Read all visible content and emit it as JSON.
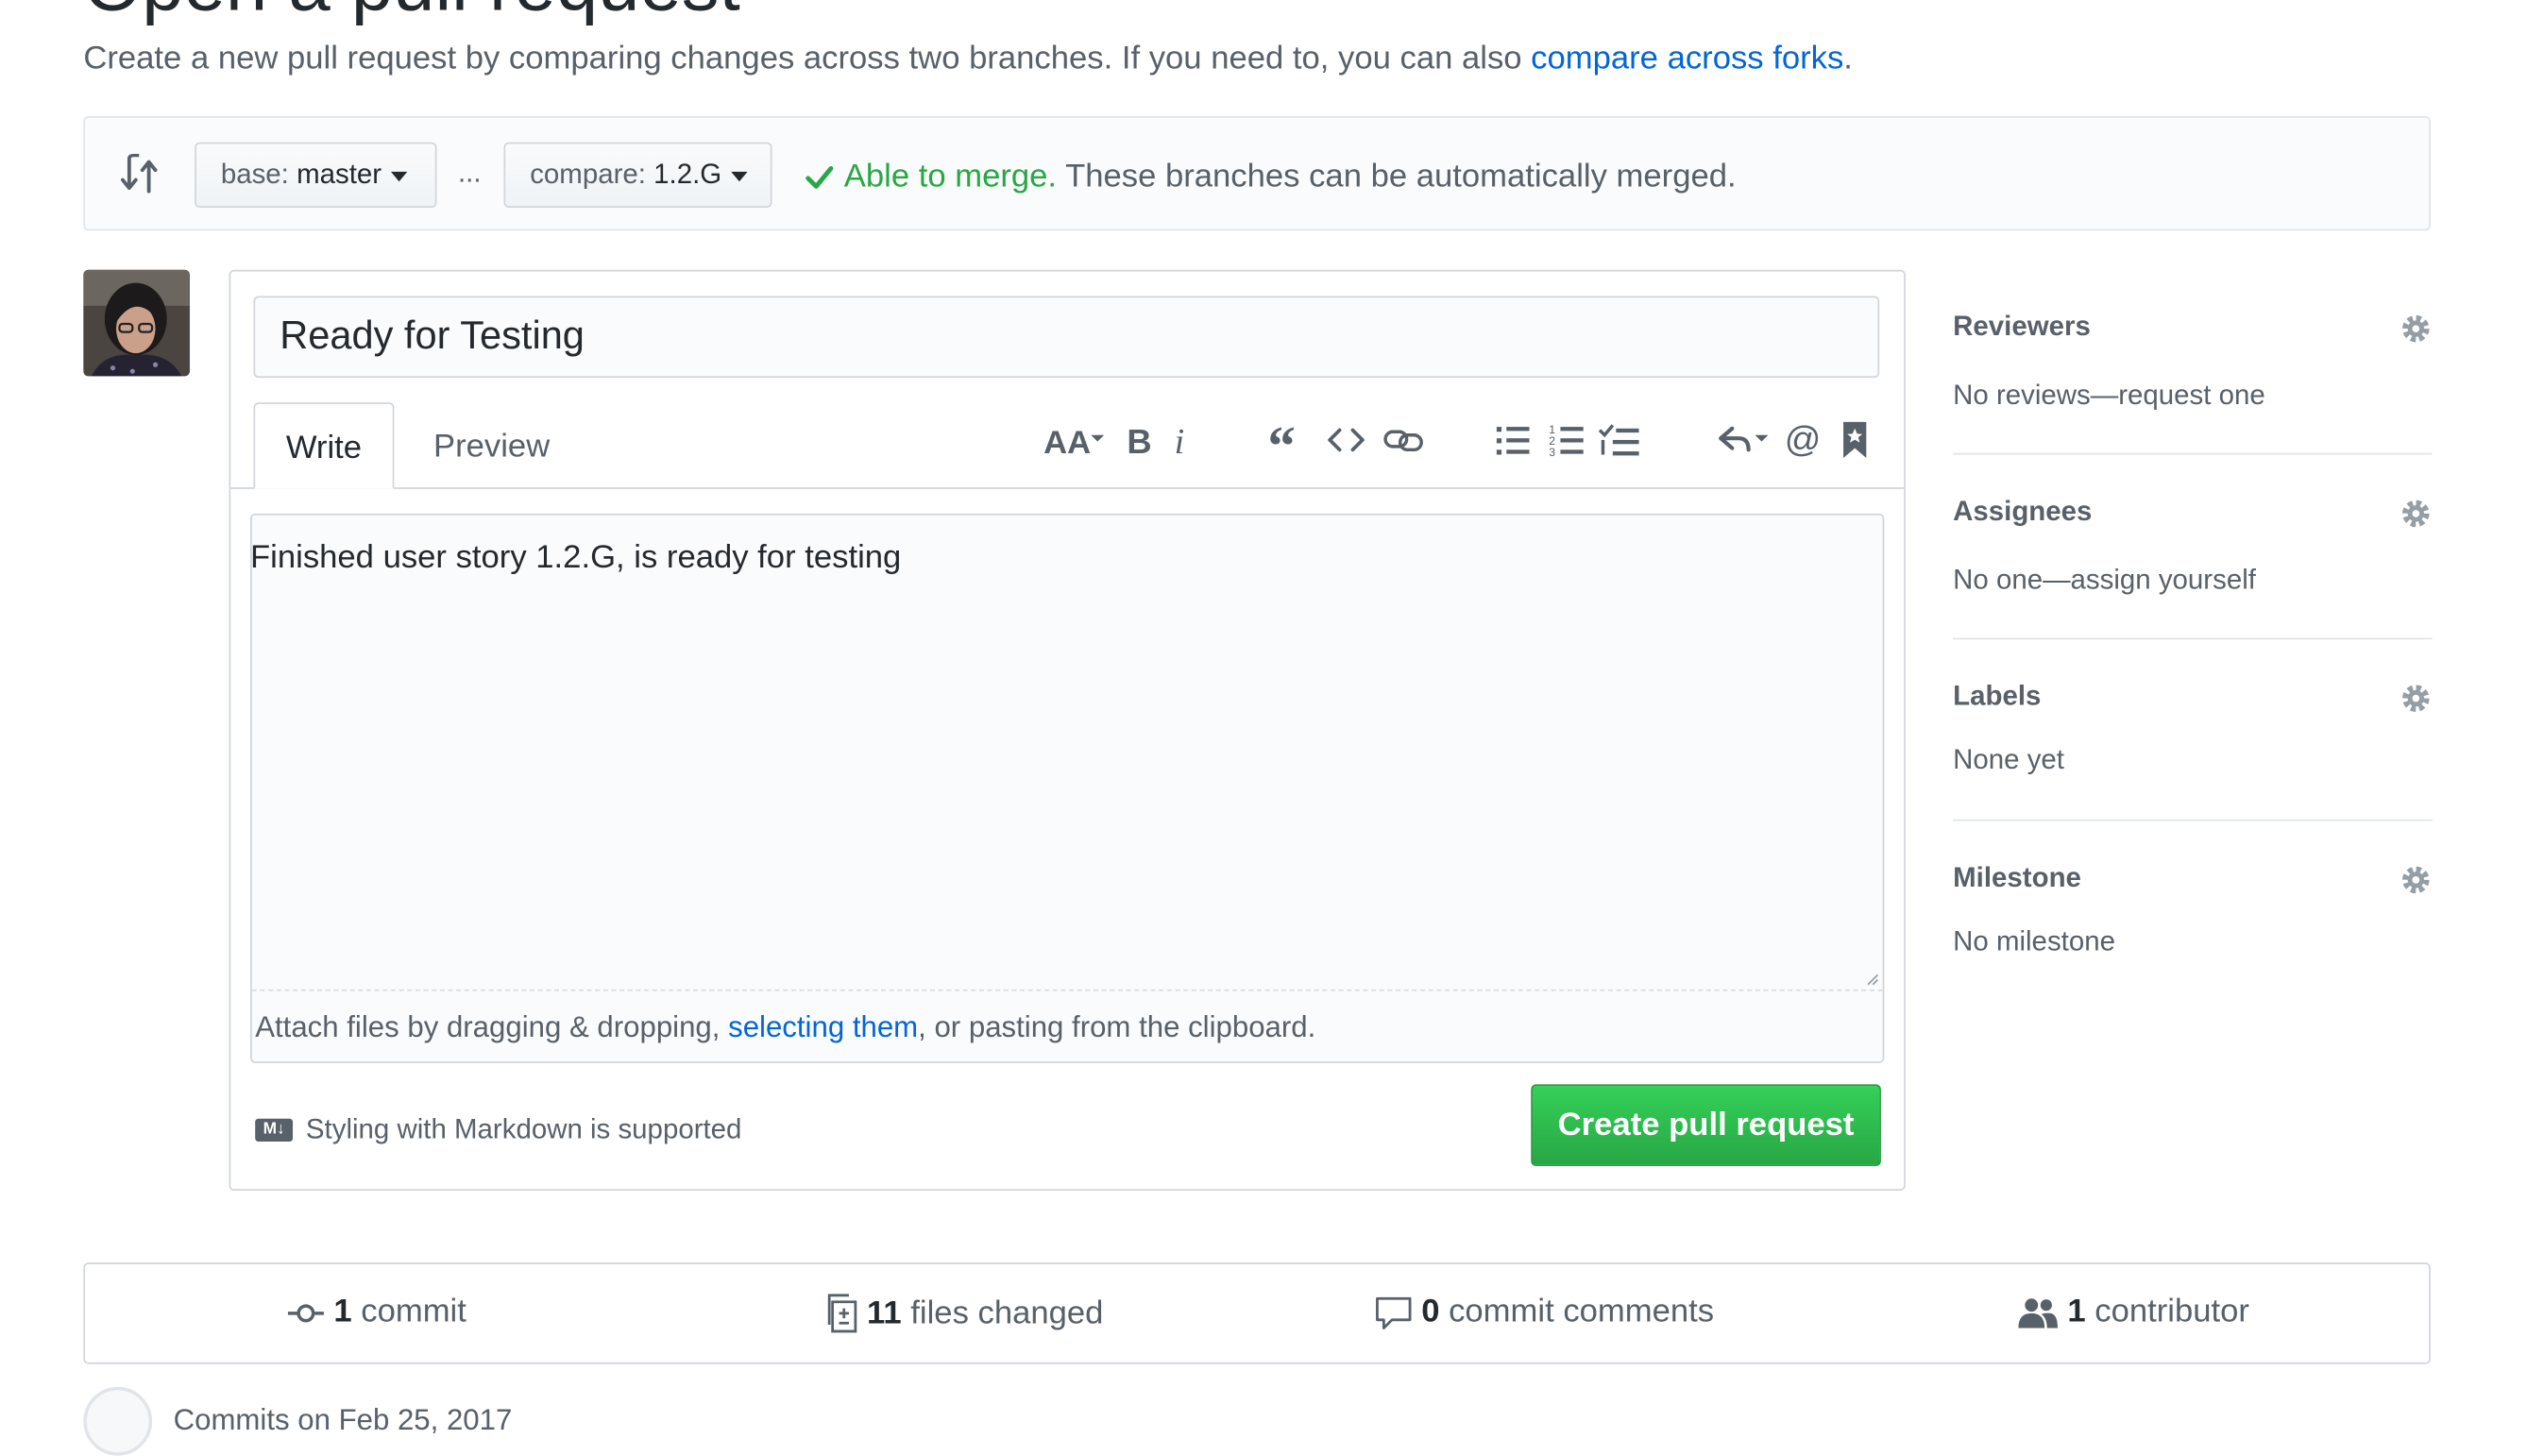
{
  "page": {
    "title": "Open a pull request",
    "subtitle_prefix": "Create a new pull request by comparing changes across two branches. If you need to, you can also ",
    "subtitle_link": "compare across forks",
    "subtitle_suffix": "."
  },
  "range": {
    "base_label": "base:",
    "base_branch": "master",
    "separator": "...",
    "compare_label": "compare:",
    "compare_branch": "1.2.G",
    "merge_status": "Able to merge.",
    "merge_message": " These branches can be automatically merged."
  },
  "composer": {
    "title_value": "Ready for Testing",
    "tab_write": "Write",
    "tab_preview": "Preview",
    "toolbar": [
      "header-text",
      "bold",
      "italic",
      "quote",
      "code",
      "link",
      "unordered-list",
      "ordered-list",
      "task-list",
      "reply",
      "mention",
      "saved-reply"
    ],
    "body_value": "Finished user story 1.2.G, is ready for testing",
    "attach_prefix": "Attach files by dragging & dropping, ",
    "attach_link": "selecting them",
    "attach_suffix": ", or pasting from the clipboard.",
    "markdown_badge": "M↓",
    "markdown_note": "Styling with Markdown is supported",
    "submit_label": "Create pull request"
  },
  "sidebar": {
    "reviewers": {
      "heading": "Reviewers",
      "value": "No reviews—request one"
    },
    "assignees": {
      "heading": "Assignees",
      "value": "No one—assign yourself"
    },
    "labels": {
      "heading": "Labels",
      "value": "None yet"
    },
    "milestone": {
      "heading": "Milestone",
      "value": "No milestone"
    }
  },
  "stats": {
    "commits": {
      "count": "1",
      "label": "commit"
    },
    "files": {
      "count": "11",
      "label": "files changed"
    },
    "comments": {
      "count": "0",
      "label": "commit comments"
    },
    "contributors": {
      "count": "1",
      "label": "contributor"
    }
  },
  "bottom": {
    "text": "Commits on Feb 25, 2017"
  },
  "colors": {
    "accent": "#0366d6",
    "success": "#28a745"
  }
}
